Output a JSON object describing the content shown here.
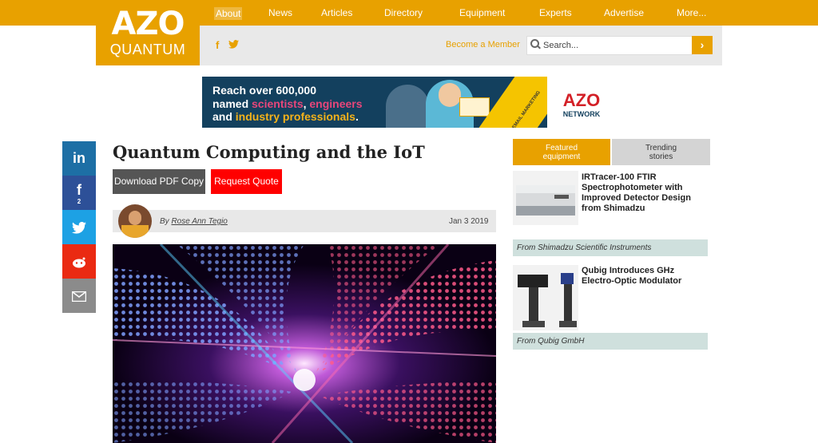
{
  "logo": {
    "line1": "AZO",
    "line2": "QUANTUM"
  },
  "nav": [
    "About",
    "News",
    "Articles",
    "Directory",
    "Equipment",
    "Experts",
    "Advertise",
    "More..."
  ],
  "header": {
    "become_member": "Become a Member",
    "search_placeholder": "Search...",
    "go_glyph": "›",
    "social": [
      "f",
      "twitter-icon"
    ]
  },
  "banner": {
    "line1a": "Reach over ",
    "line1b": "600,000",
    "line2a": "named ",
    "line2b": "scientists",
    "line2c": ", ",
    "line2d": "engineers",
    "line3a": "and ",
    "line3b": "industry professionals",
    "line3c": ".",
    "ribbon": "EMAIL MARKETING",
    "brand": "AZO",
    "brand_sub": "NETWORK"
  },
  "share": {
    "facebook_count": "2"
  },
  "article": {
    "title": "Quantum Computing and the IoT",
    "download_label": "Download PDF Copy",
    "quote_label": "Request Quote",
    "by": "By ",
    "author": "Rose Ann Tegio",
    "date": "Jan 3 2019"
  },
  "sidebar": {
    "tab_featured_1": "Featured",
    "tab_featured_2": "equipment",
    "tab_trending_1": "Trending",
    "tab_trending_2": "stories",
    "items": [
      {
        "title_1": "IRTracer-100 FTIR",
        "title_2": "Spectrophotometer with",
        "title_3": "Improved Detector Design",
        "title_4": "from Shimadzu",
        "from": "From ",
        "source": "Shimadzu Scientific Instruments"
      },
      {
        "title_1": "Qubig Introduces GHz",
        "title_2": "Electro-Optic Modulator",
        "from": "From ",
        "source": "Qubig GmbH"
      }
    ]
  },
  "colors": {
    "brand": "#e8a100",
    "quote": "#ff0000",
    "from_bg": "#cfe0dd"
  }
}
